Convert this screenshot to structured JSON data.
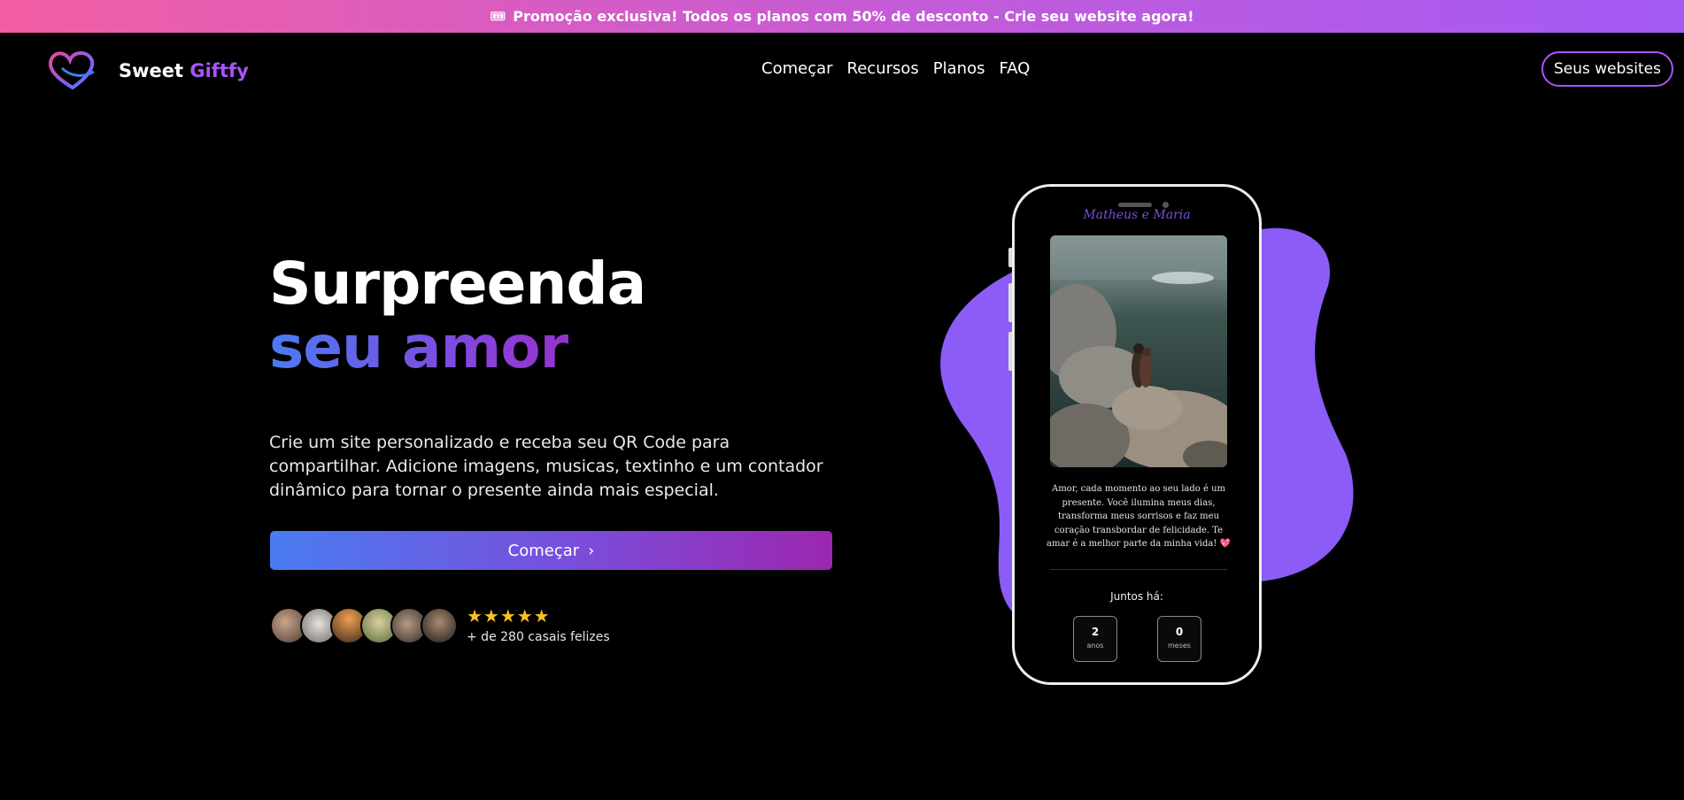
{
  "promo": {
    "icon": "ticket-icon",
    "text": "Promoção exclusiva! Todos os planos com 50% de desconto - Crie seu website agora!"
  },
  "nav": {
    "brand_part1": "Sweet",
    "brand_part2": "Giftfy",
    "links": [
      "Começar",
      "Recursos",
      "Planos",
      "FAQ"
    ],
    "cta": "Seus websites"
  },
  "hero": {
    "title_line1": "Surpreenda",
    "title_line2": "seu amor",
    "description": "Crie um site personalizado e receba seu QR Code para compartilhar. Adicione imagens, musicas, textinho e um contador dinâmico para tornar o presente ainda mais especial.",
    "cta_label": "Começar",
    "stars": "★★★★★",
    "rating": 5,
    "happy_text": "+ de 280 casais felizes"
  },
  "phone": {
    "couple_name": "Matheus e Maria",
    "message": "Amor, cada momento ao seu lado é um presente. Você ilumina meus dias, transforma meus sorrisos e faz meu coração transbordar de felicidade. Te amar é a melhor parte da minha vida! 💖",
    "together_label": "Juntos há:",
    "counters": [
      {
        "value": "2",
        "unit": "anos"
      },
      {
        "value": "0",
        "unit": "meses"
      }
    ]
  },
  "colors": {
    "accent": "#a855f7",
    "blob": "#8b5cf6",
    "star": "#fbbf24"
  }
}
